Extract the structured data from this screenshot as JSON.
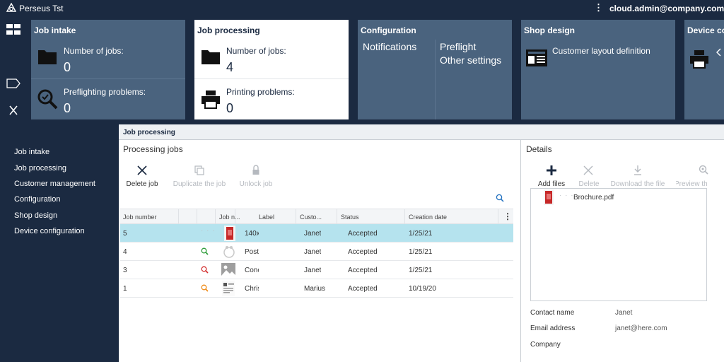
{
  "app": {
    "title": "Perseus Tst",
    "user": "cloud.admin@company.com"
  },
  "tiles": {
    "job_intake": {
      "title": "Job intake",
      "jobs_label": "Number of jobs:",
      "jobs_value": "0",
      "problems_label": "Preflighting problems:",
      "problems_value": "0"
    },
    "job_processing": {
      "title": "Job processing",
      "jobs_label": "Number of jobs:",
      "jobs_value": "4",
      "problems_label": "Printing problems:",
      "problems_value": "0"
    },
    "configuration": {
      "title": "Configuration",
      "notifications": "Notifications",
      "preflight": "Preflight",
      "other_settings": "Other settings"
    },
    "shop_design": {
      "title": "Shop design",
      "customer_layout": "Customer layout definition"
    },
    "device": {
      "title": "Device co"
    }
  },
  "nav": {
    "items": [
      "Job intake",
      "Job processing",
      "Customer management",
      "Configuration",
      "Shop design",
      "Device configuration"
    ]
  },
  "main": {
    "title": "Job processing",
    "processing_jobs_title": "Processing jobs",
    "toolbar": {
      "delete_job": "Delete job",
      "duplicate_job": "Duplicate the job",
      "unlock_job": "Unlock job"
    },
    "columns": [
      "Job number",
      "Job n...",
      "Label",
      "Custo...",
      "Status",
      "Creation date"
    ],
    "rows": [
      {
        "job_number": "5",
        "job_name": "140x",
        "label": "",
        "customer": "Janet",
        "status": "Accepted",
        "created": "1/25/21",
        "flag": "",
        "selected": true
      },
      {
        "job_number": "4",
        "job_name": "Post",
        "label": "",
        "customer": "Janet",
        "status": "Accepted",
        "created": "1/25/21",
        "flag": "green",
        "selected": false
      },
      {
        "job_number": "3",
        "job_name": "Conc",
        "label": "",
        "customer": "Janet",
        "status": "Accepted",
        "created": "1/25/21",
        "flag": "red",
        "selected": false
      },
      {
        "job_number": "1",
        "job_name": "Chris",
        "label": "",
        "customer": "Marius",
        "status": "Accepted",
        "created": "10/19/20",
        "flag": "orange",
        "selected": false
      }
    ],
    "details": {
      "title": "Details",
      "toolbar": {
        "add_files": "Add files",
        "delete": "Delete",
        "download": "Download the file",
        "preview": "Preview th"
      },
      "file_name": "Brochure.pdf",
      "contact_name_label": "Contact name",
      "contact_name_value": "Janet",
      "email_label": "Email address",
      "email_value": "janet@here.com",
      "company_label": "Company",
      "company_value": ""
    }
  },
  "colors": {
    "navy": "#1b2a41",
    "tile": "#4a637e",
    "selected_row": "#b5e3ee",
    "accent_blue": "#1f6fbf"
  }
}
